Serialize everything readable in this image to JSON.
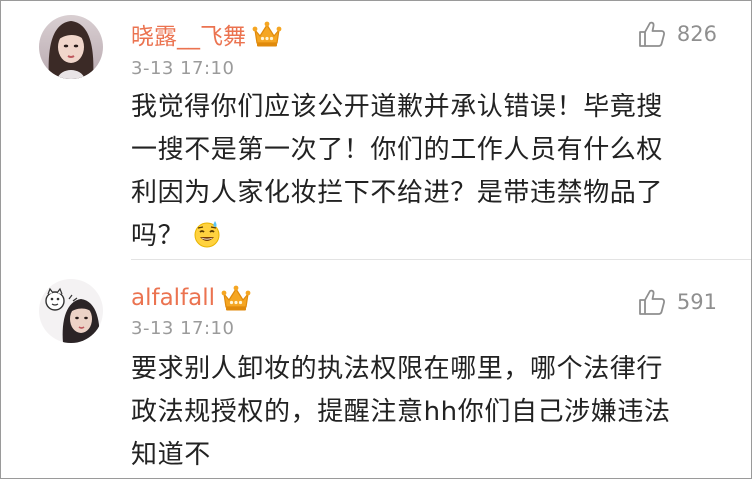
{
  "comments": [
    {
      "username": "晓露__飞舞",
      "timestamp": "3-13 17:10",
      "likes": "826",
      "badge_icon": "crown-icon",
      "text_lines": [
        "我觉得你们应该公开道歉并承认错误！毕竟搜",
        "一搜不是第一次了！你们的工作人员有什么权",
        "利因为人家化妆拦下不给进？是带违禁物品了",
        "吗？"
      ],
      "trailing_emoji": "sweat-smile-emoji-icon"
    },
    {
      "username": "alfalfall",
      "timestamp": "3-13 17:10",
      "likes": "591",
      "badge_icon": "crown-icon",
      "text_lines": [
        "要求别人卸妆的执法权限在哪里，哪个法律行",
        "政法规授权的，提醒注意hh你们自己涉嫌违法",
        "知道不"
      ]
    }
  ],
  "colors": {
    "username": "#eb7350",
    "timestamp": "#9b9b9b",
    "body_text": "#222222",
    "like_count": "#8f8f8f",
    "crown": "#f5a623"
  }
}
